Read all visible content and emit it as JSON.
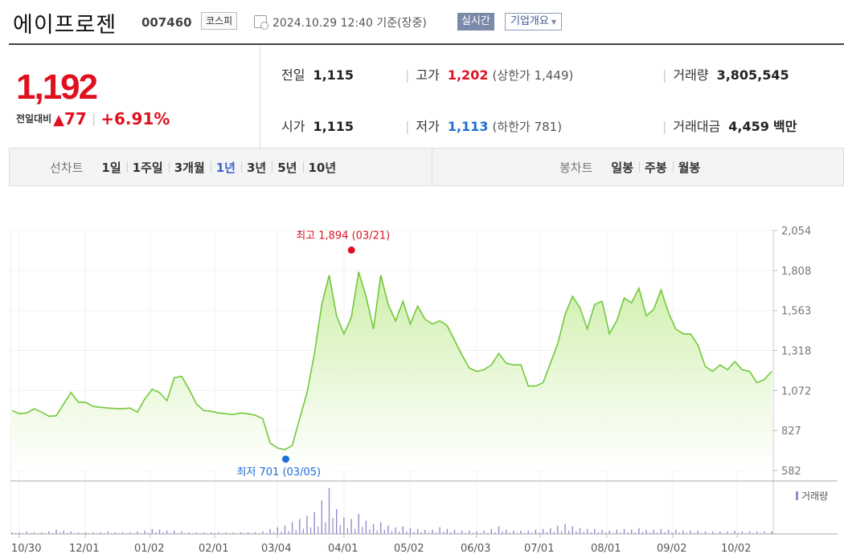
{
  "header": {
    "company": "에이프로젠",
    "code": "007460",
    "market": "코스피",
    "datetime": "2024.10.29 12:40  기준(장중)",
    "realtime": "실시간",
    "overview": "기업개요"
  },
  "quote": {
    "price": "1,192",
    "change_label": "전일대비",
    "change_arrow": "▲",
    "change": "77",
    "change_pct": "+6.91%",
    "prev_label": "전일",
    "prev": "1,115",
    "open_label": "시가",
    "open": "1,115",
    "high_label": "고가",
    "high": "1,202",
    "upper_limit": "(상한가 1,449)",
    "low_label": "저가",
    "low": "1,113",
    "lower_limit": "(하한가 781)",
    "volume_label": "거래량",
    "volume": "3,805,545",
    "amount_label": "거래대금",
    "amount": "4,459",
    "amount_unit": "백만"
  },
  "tabs": {
    "line_label": "선차트",
    "line": [
      "1일",
      "1주일",
      "3개월",
      "1년",
      "3년",
      "5년",
      "10년"
    ],
    "active": "1년",
    "candle_label": "봉차트",
    "candle": [
      "일봉",
      "주봉",
      "월봉"
    ]
  },
  "chart_data": {
    "type": "area",
    "y_ticks": [
      "2,054",
      "1,808",
      "1,563",
      "1,318",
      "1,072",
      "827",
      "582"
    ],
    "ylim": [
      582,
      2054
    ],
    "x_ticks": [
      "10/30",
      "12/01",
      "01/02",
      "02/01",
      "03/04",
      "04/01",
      "05/02",
      "06/03",
      "07/01",
      "08/01",
      "09/02",
      "10/02"
    ],
    "high_annotation": "최고 1,894 (03/21)",
    "low_annotation": "최저 701 (03/05)",
    "high_value": 1894,
    "low_value": 701,
    "volume_legend": "거래량",
    "colors": {
      "line": "#72c83a",
      "fill_top": "#cdefa9",
      "high": "#e0111f",
      "low": "#1d6fd6",
      "volume": "#9b88cf"
    },
    "series": [
      {
        "name": "",
        "values": [
          950,
          930,
          935,
          960,
          940,
          915,
          918,
          990,
          1060,
          1000,
          1000,
          975,
          970,
          965,
          962,
          960,
          965,
          940,
          1020,
          1080,
          1060,
          1010,
          1150,
          1160,
          1080,
          990,
          950,
          945,
          935,
          930,
          925,
          935,
          930,
          920,
          900,
          750,
          720,
          710,
          735,
          900,
          1060,
          1300,
          1600,
          1780,
          1530,
          1420,
          1520,
          1800,
          1650,
          1450,
          1780,
          1600,
          1500,
          1620,
          1480,
          1590,
          1510,
          1480,
          1500,
          1470,
          1380,
          1290,
          1210,
          1190,
          1200,
          1230,
          1300,
          1240,
          1230,
          1230,
          1100,
          1100,
          1120,
          1240,
          1360,
          1540,
          1650,
          1580,
          1450,
          1600,
          1620,
          1420,
          1500,
          1640,
          1610,
          1700,
          1530,
          1570,
          1690,
          1550,
          1450,
          1420,
          1420,
          1350,
          1220,
          1190,
          1230,
          1200,
          1250,
          1200,
          1190,
          1120,
          1140,
          1190
        ]
      }
    ],
    "volume": [
      2,
      2,
      3,
      2,
      2,
      3,
      5,
      4,
      3,
      2,
      2,
      2,
      2,
      3,
      2,
      2,
      2,
      3,
      4,
      6,
      5,
      4,
      4,
      3,
      2,
      2,
      2,
      2,
      2,
      2,
      2,
      2,
      2,
      2,
      3,
      6,
      8,
      10,
      14,
      18,
      22,
      26,
      40,
      55,
      30,
      20,
      18,
      24,
      16,
      12,
      14,
      10,
      8,
      9,
      7,
      6,
      5,
      5,
      8,
      6,
      5,
      4,
      4,
      3,
      4,
      6,
      9,
      5,
      4,
      4,
      4,
      5,
      6,
      7,
      10,
      12,
      9,
      7,
      6,
      6,
      5,
      4,
      5,
      6,
      5,
      7,
      5,
      5,
      6,
      5,
      5,
      4,
      4,
      4,
      3,
      3,
      3,
      3,
      4,
      3,
      3,
      3,
      3,
      3
    ]
  }
}
